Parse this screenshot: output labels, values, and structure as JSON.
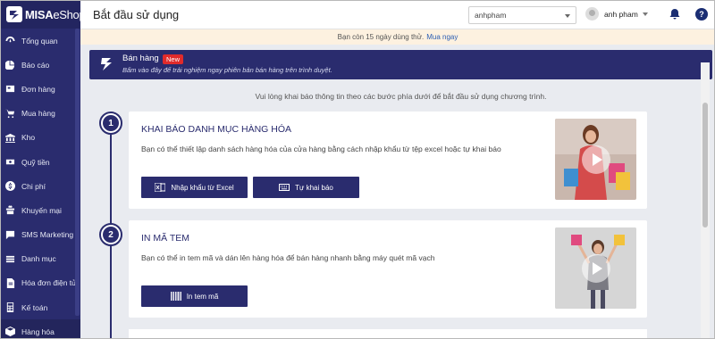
{
  "sidebar": {
    "logo_bold": "MISA",
    "logo_rest": "eShop",
    "items": [
      {
        "label": "Tổng quan",
        "icon": "dashboard-icon"
      },
      {
        "label": "Báo cáo",
        "icon": "pie-chart-icon"
      },
      {
        "label": "Đơn hàng",
        "icon": "order-icon"
      },
      {
        "label": "Mua hàng",
        "icon": "cart-icon"
      },
      {
        "label": "Kho",
        "icon": "warehouse-icon"
      },
      {
        "label": "Quỹ tiền",
        "icon": "money-icon"
      },
      {
        "label": "Chi phí",
        "icon": "expense-icon"
      },
      {
        "label": "Khuyến mại",
        "icon": "promotion-icon"
      },
      {
        "label": "SMS Marketing",
        "icon": "sms-icon"
      },
      {
        "label": "Danh mục",
        "icon": "catalog-icon"
      },
      {
        "label": "Hóa đơn điện tử",
        "icon": "e-invoice-icon"
      },
      {
        "label": "Kế toán",
        "icon": "accounting-icon"
      },
      {
        "label": "Hàng hóa",
        "icon": "goods-icon"
      }
    ]
  },
  "header": {
    "title": "Bắt đầu sử dụng",
    "store_value": "anhpham",
    "user_name": "anh pham",
    "help_label": "?"
  },
  "trial": {
    "text": "Bạn còn 15 ngày dùng thử.",
    "link": "Mua ngay"
  },
  "banner": {
    "title": "Bán hàng",
    "badge": "New",
    "desc": "Bấm vào đây để trải nghiệm ngay phiên bản bán hàng trên trình duyệt."
  },
  "instruction": "Vui lòng khai báo thông tin theo các bước phía dưới để bắt đầu sử dụng chương trình.",
  "steps": [
    {
      "number": "1",
      "title": "KHAI BÁO DANH MỤC HÀNG HÓA",
      "desc": "Bạn có thể thiết lập danh sách hàng hóa của cửa hàng bằng cách nhập khẩu từ tệp excel hoặc tự khai báo",
      "buttons": [
        "Nhập khẩu từ Excel",
        "Tự khai báo"
      ]
    },
    {
      "number": "2",
      "title": "IN MÃ TEM",
      "desc": "Bạn có thể in tem mã và dán lên hàng hóa để bán hàng nhanh bằng máy quét mã vạch",
      "buttons": [
        "In tem mã"
      ]
    }
  ],
  "colors": {
    "primary": "#2a2c6e",
    "badge": "#e02b2b",
    "trial_bg": "#fdf1e0",
    "link": "#2d5fb3"
  }
}
